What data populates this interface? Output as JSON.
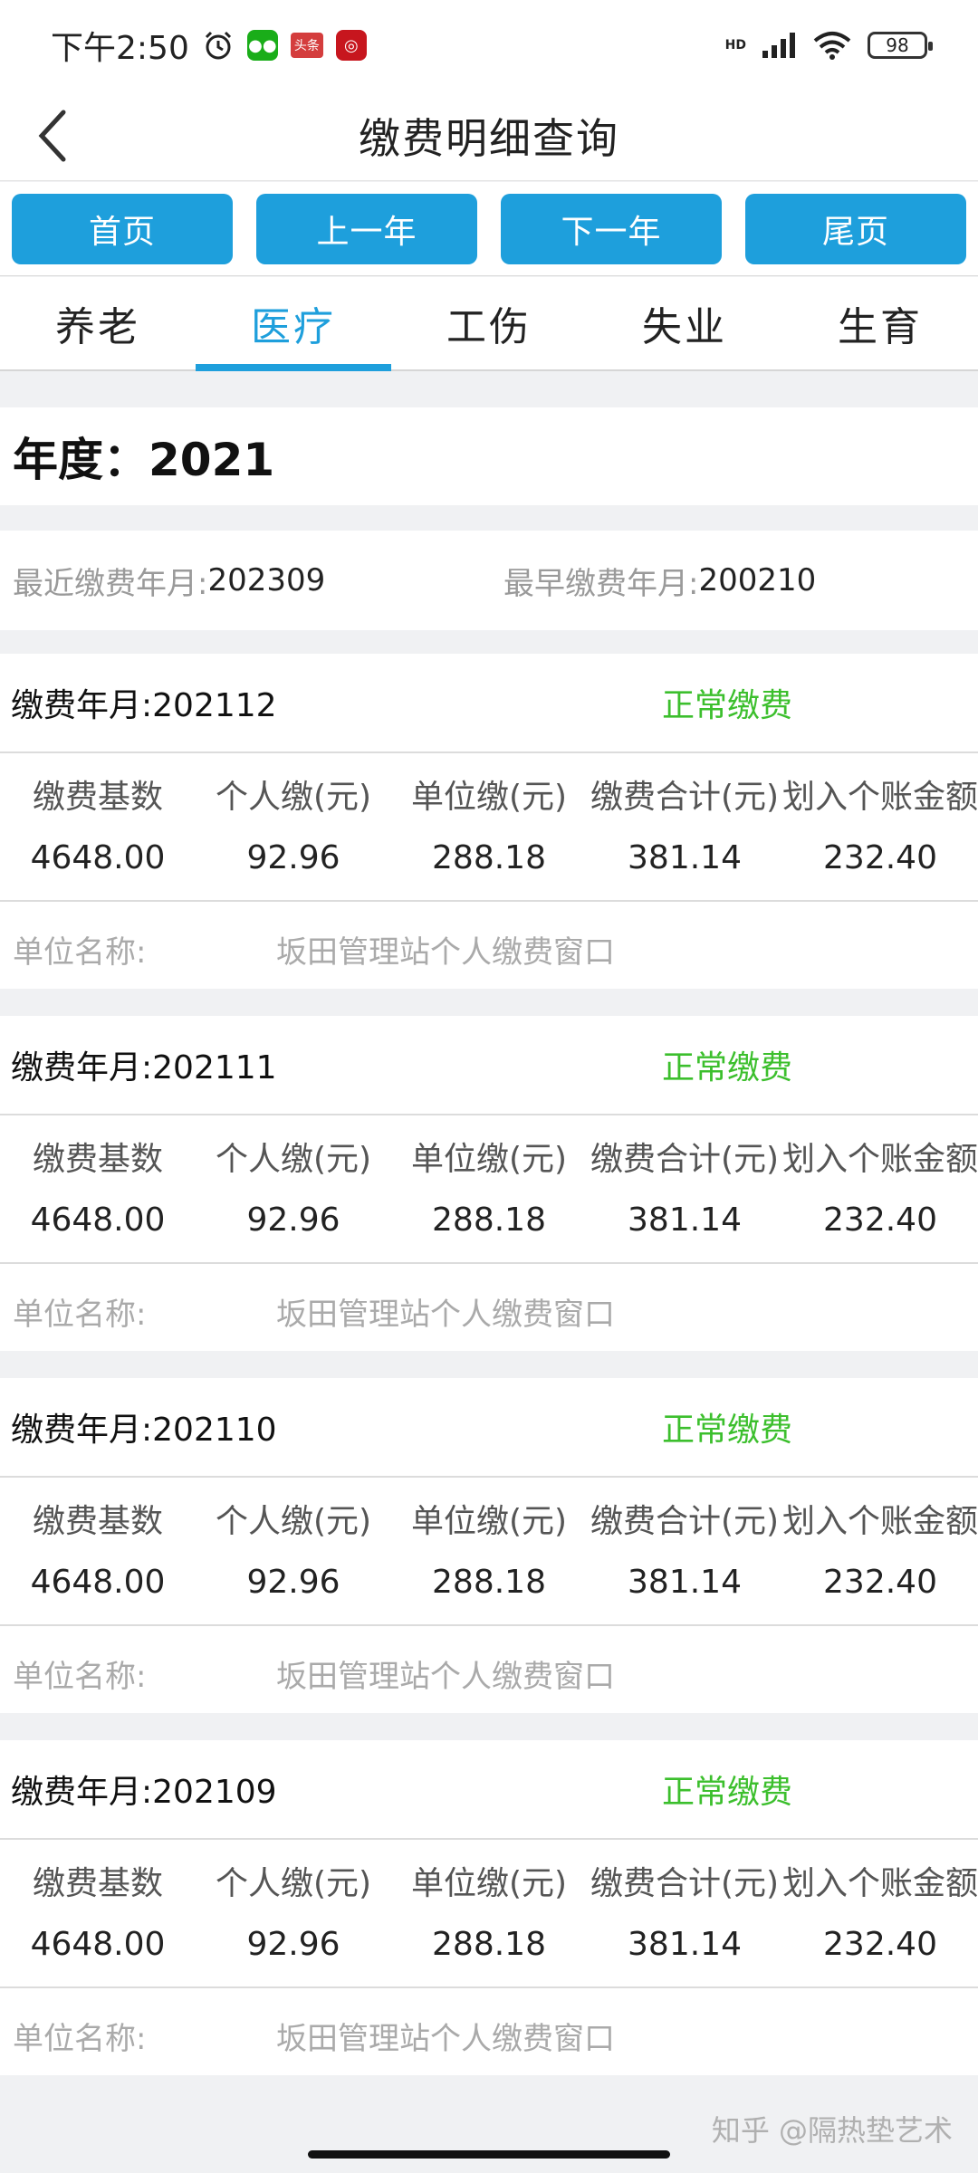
{
  "status_bar": {
    "time": "下午2:50",
    "app_icons": [
      "alarm-icon",
      "wechat-icon",
      "toutiao-icon",
      "bank-app-icon"
    ],
    "toutiao_label": "头条",
    "hd_label": "HD",
    "battery": "98"
  },
  "nav": {
    "title": "缴费明细查询"
  },
  "paging": {
    "first": "首页",
    "prev_year": "上一年",
    "next_year": "下一年",
    "last": "尾页"
  },
  "tabs": [
    {
      "label": "养老",
      "active": false
    },
    {
      "label": "医疗",
      "active": true
    },
    {
      "label": "工伤",
      "active": false
    },
    {
      "label": "失业",
      "active": false
    },
    {
      "label": "生育",
      "active": false
    }
  ],
  "year": {
    "label": "年度：2021"
  },
  "summary": {
    "latest_label": "最近缴费年月:",
    "latest_value": "202309",
    "earliest_label": "最早缴费年月:",
    "earliest_value": "200210"
  },
  "columns": [
    "缴费基数",
    "个人缴(元)",
    "单位缴(元)",
    "缴费合计(元)",
    "划入个账金额"
  ],
  "records": [
    {
      "month": "缴费年月:202112",
      "status": "正常缴费",
      "values": [
        "4648.00",
        "92.96",
        "288.18",
        "381.14",
        "232.40"
      ],
      "unit_label": "单位名称:",
      "unit_name": "坂田管理站个人缴费窗口"
    },
    {
      "month": "缴费年月:202111",
      "status": "正常缴费",
      "values": [
        "4648.00",
        "92.96",
        "288.18",
        "381.14",
        "232.40"
      ],
      "unit_label": "单位名称:",
      "unit_name": "坂田管理站个人缴费窗口"
    },
    {
      "month": "缴费年月:202110",
      "status": "正常缴费",
      "values": [
        "4648.00",
        "92.96",
        "288.18",
        "381.14",
        "232.40"
      ],
      "unit_label": "单位名称:",
      "unit_name": "坂田管理站个人缴费窗口"
    },
    {
      "month": "缴费年月:202109",
      "status": "正常缴费",
      "values": [
        "4648.00",
        "92.96",
        "288.18",
        "381.14",
        "232.40"
      ],
      "unit_label": "单位名称:",
      "unit_name": "坂田管理站个人缴费窗口"
    }
  ],
  "colors": {
    "accent": "#1e9fdc",
    "status_ok": "#3cbf2d"
  },
  "watermark": "知乎 @隔热垫艺术"
}
